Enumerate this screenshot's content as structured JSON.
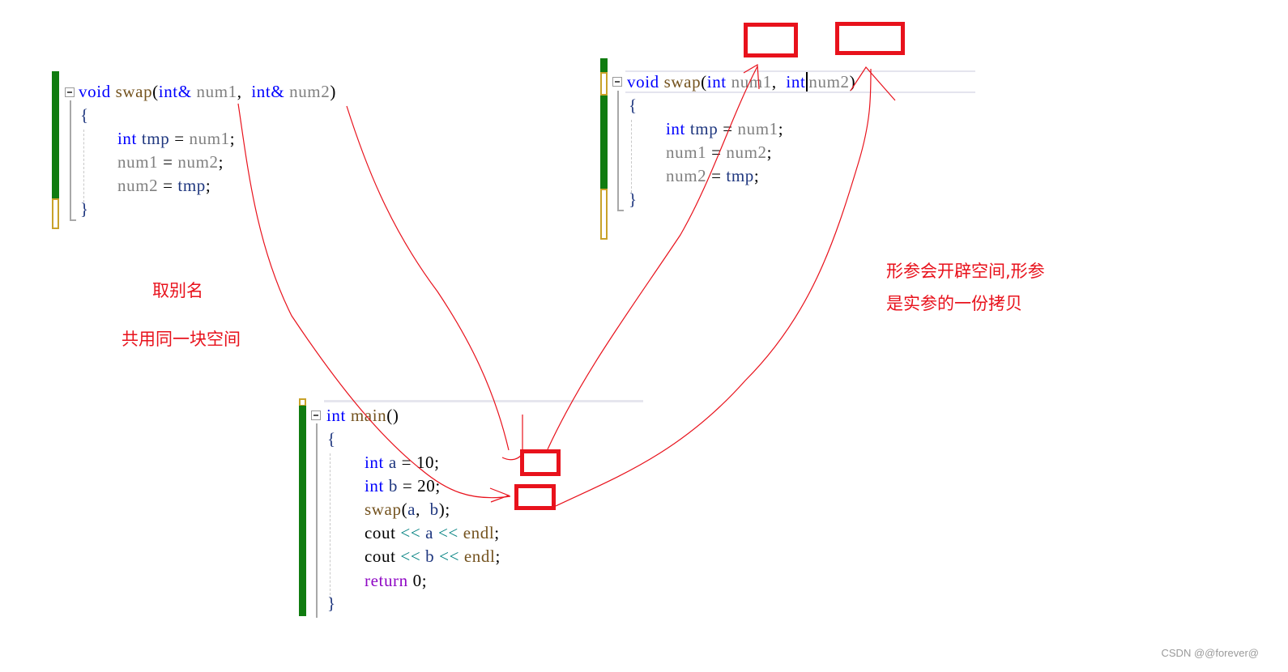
{
  "code_blocks": {
    "swap_ref": {
      "signature": {
        "ret": "void",
        "name": "swap",
        "open": "(",
        "t1": "int&",
        "p1": "num1",
        "comma": ",",
        "t2": "int&",
        "p2": "num2",
        "close": ")"
      },
      "open_brace": "{",
      "lines": [
        {
          "kw": "int",
          "var": "tmp",
          "op": "=",
          "rhs": "num1",
          "end": ";"
        },
        {
          "lhs": "num1",
          "op": "=",
          "rhs": "num2",
          "end": ";"
        },
        {
          "lhs": "num2",
          "op": "=",
          "rhs": "tmp",
          "end": ";"
        }
      ],
      "close_brace": "}"
    },
    "swap_val": {
      "signature": {
        "ret": "void",
        "name": "swap",
        "open": "(",
        "t1": "int",
        "p1": "num1",
        "comma": ",",
        "t2": "int",
        "p2": "num2",
        "close": ")"
      },
      "open_brace": "{",
      "lines": [
        {
          "kw": "int",
          "var": "tmp",
          "op": "=",
          "rhs": "num1",
          "end": ";"
        },
        {
          "lhs": "num1",
          "op": "=",
          "rhs": "num2",
          "end": ";"
        },
        {
          "lhs": "num2",
          "op": "=",
          "rhs": "tmp",
          "end": ";"
        }
      ],
      "close_brace": "}"
    },
    "main": {
      "signature": {
        "ret": "int",
        "name": "main",
        "parens": "()"
      },
      "open_brace": "{",
      "decl_a": {
        "kw": "int",
        "var": "a",
        "op": "=",
        "val": "10",
        "end": ";"
      },
      "decl_b": {
        "kw": "int",
        "var": "b",
        "op": "=",
        "val": "20",
        "end": ";"
      },
      "call": {
        "fn": "swap",
        "open": "(",
        "a1": "a",
        "comma": ",",
        "a2": "b",
        "close": ")",
        "end": ";"
      },
      "cout_a": {
        "obj": "cout",
        "op1": "<<",
        "v": "a",
        "op2": "<<",
        "endl": "endl",
        "end": ";"
      },
      "cout_b": {
        "obj": "cout",
        "op1": "<<",
        "v": "b",
        "op2": "<<",
        "endl": "endl",
        "end": ";"
      },
      "ret": {
        "kw": "return",
        "val": "0",
        "end": ";"
      },
      "close_brace": "}"
    }
  },
  "annotations": {
    "reference_title": "取别名",
    "reference_desc": "共用同一块空间",
    "value_desc_line1": "形参会开辟空间,形参",
    "value_desc_line2": "是实参的一份拷贝"
  },
  "colors": {
    "annotation": "#e8121c",
    "keyword": "#0000ff",
    "function": "#74531f",
    "parameter": "#808080",
    "local": "#1f377f",
    "control": "#8f08c4",
    "change_bar_saved": "#107c10",
    "change_bar_unsaved": "#c8a22a"
  },
  "watermark": "CSDN @@forever@"
}
